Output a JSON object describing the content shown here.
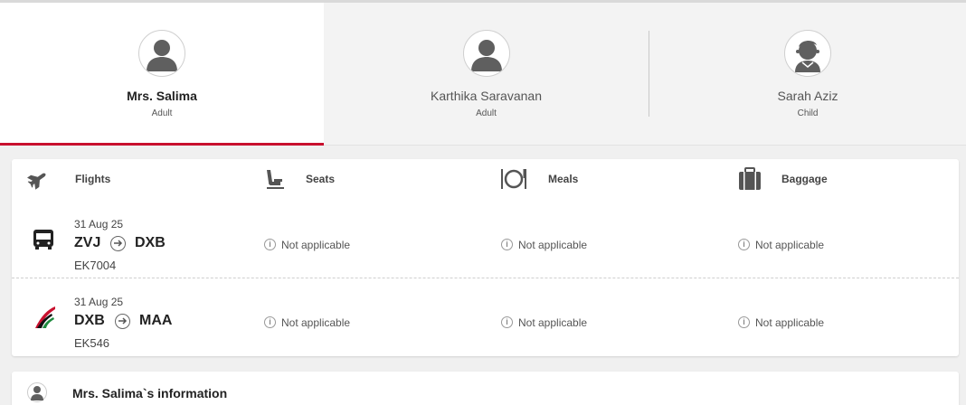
{
  "passengers": [
    {
      "name": "Mrs. Salima",
      "type": "Adult",
      "selected": true,
      "avatar_icon": "person-icon"
    },
    {
      "name": "Karthika Saravanan",
      "type": "Adult",
      "selected": false,
      "avatar_icon": "person-icon"
    },
    {
      "name": "Sarah Aziz",
      "type": "Child",
      "selected": false,
      "avatar_icon": "child-icon"
    }
  ],
  "columns": [
    {
      "label": "Flights",
      "icon": "airplane-icon"
    },
    {
      "label": "Seats",
      "icon": "seat-icon"
    },
    {
      "label": "Meals",
      "icon": "meal-icon"
    },
    {
      "label": "Baggage",
      "icon": "baggage-icon"
    }
  ],
  "segments": [
    {
      "date": "31 Aug 25",
      "from": "ZVJ",
      "to": "DXB",
      "flight": "EK7004",
      "carrier_icon": "bus-icon",
      "seats": "Not applicable",
      "meals": "Not applicable",
      "baggage": "Not applicable"
    },
    {
      "date": "31 Aug 25",
      "from": "DXB",
      "to": "MAA",
      "flight": "EK546",
      "carrier_icon": "emirates-logo-icon",
      "seats": "Not applicable",
      "meals": "Not applicable",
      "baggage": "Not applicable"
    }
  ],
  "info_section": {
    "title": "Mrs. Salima`s information"
  },
  "colors": {
    "accent": "#c8102e"
  }
}
